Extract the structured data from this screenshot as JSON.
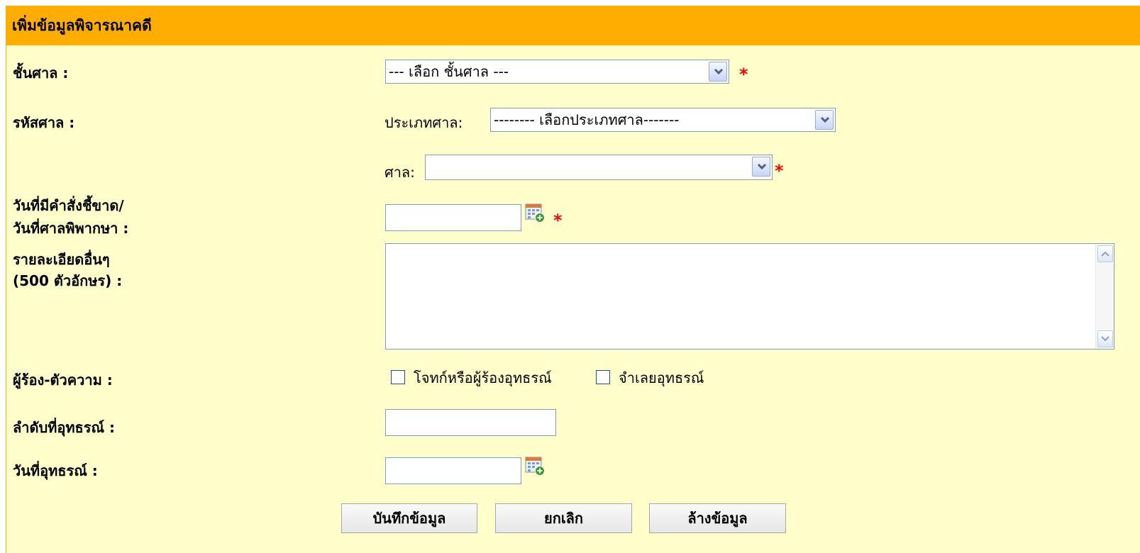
{
  "header": {
    "title": "เพิ่มข้อมูลพิจารณาคดี"
  },
  "fields": {
    "court_level": {
      "label": "ชั้นศาล :",
      "value": "--- เลือก ชั้นศาล ---"
    },
    "court_code": {
      "label": "รหัสศาล :"
    },
    "court_type": {
      "label": "ประเภทศาล:",
      "value": "-------- เลือกประเภทศาล-------"
    },
    "court": {
      "label": "ศาล:",
      "value": ""
    },
    "order_date": {
      "label_line1": "วันที่มีคำสั่งชี้ขาด/",
      "label_line2": "วันที่ศาลพิพากษา :",
      "value": ""
    },
    "details": {
      "label_line1": "รายละเอียดอื่นๆ",
      "label_line2": "(500 ตัวอักษร) :",
      "value": ""
    },
    "parties": {
      "label": "ผู้ร้อง-ตัวความ :",
      "option1": "โจทก์หรือผู้ร้องอุทธรณ์",
      "option2": "จำเลยอุทธรณ์",
      "option1_checked": false,
      "option2_checked": false
    },
    "appeal_number": {
      "label": "ลำดับที่อุทธรณ์ :",
      "value": ""
    },
    "appeal_date": {
      "label": "วันที่อุทธรณ์ :",
      "value": ""
    }
  },
  "required_mark": "*",
  "buttons": {
    "save": "บันทึกข้อมูล",
    "cancel": "ยกเลิก",
    "clear": "ล้างข้อมูล"
  },
  "icons": {
    "dropdown": "chevron-down-icon",
    "calendar": "calendar-add-icon"
  }
}
